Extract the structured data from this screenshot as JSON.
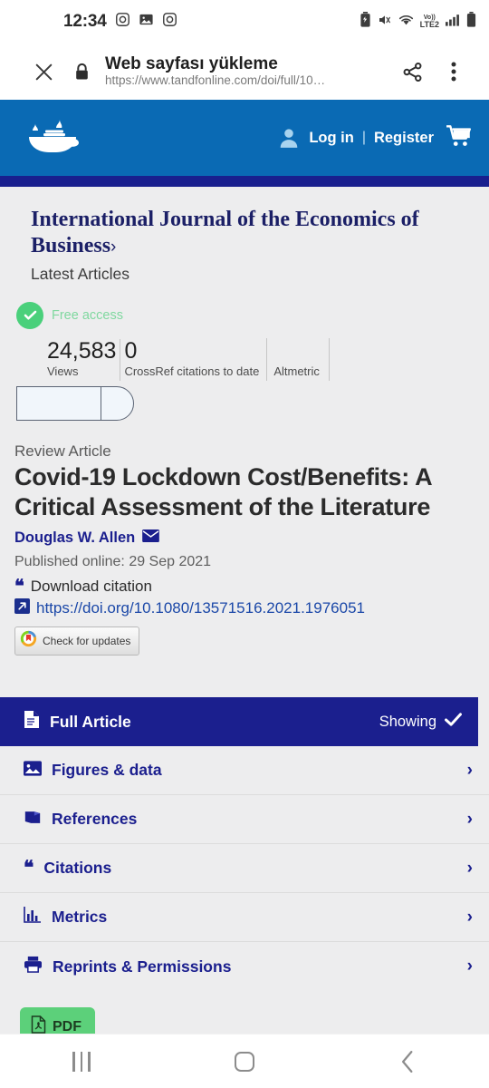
{
  "status_bar": {
    "time": "12:34",
    "left_icons": [
      "instagram-icon",
      "gallery-icon",
      "instagram-icon"
    ],
    "right_icons": [
      "battery-saver-icon",
      "vibrate-icon",
      "wifi-icon",
      "volte-lte2-icon",
      "signal-bars-icon",
      "battery-icon"
    ],
    "network_label": "Vo))",
    "network_type": "LTE2"
  },
  "browser": {
    "title": "Web sayfası yükleme",
    "url": "https://www.tandfonline.com/doi/full/10…",
    "close_icon": "close-icon",
    "lock_icon": "lock-icon",
    "share_icon": "share-icon",
    "menu_icon": "more-vertical-icon"
  },
  "site_header": {
    "logo": "taylor-francis-lamp-logo",
    "login_label": "Log in",
    "separator": "|",
    "register_label": "Register",
    "cart_icon": "shopping-cart-icon",
    "account_icon": "user-avatar-icon",
    "bg_color": "#0a6ab4",
    "strip_color": "#191f8e"
  },
  "journal": {
    "title": "International Journal of the Economics of Business",
    "chevron": "›",
    "subtitle": "Latest Articles"
  },
  "access": {
    "badge_label": "Free access",
    "badge_icon": "check-circle-icon",
    "badge_color": "#4ad07b"
  },
  "metrics": [
    {
      "value": "24,583",
      "label": "Views"
    },
    {
      "value": "0",
      "label": "CrossRef citations to date"
    },
    {
      "value": "",
      "label": "Altmetric"
    }
  ],
  "article": {
    "type": "Review Article",
    "title": "Covid-19 Lockdown Cost/Benefits: A Critical Assessment of the Literature",
    "author": "Douglas W. Allen",
    "author_mail_icon": "envelope-icon",
    "published": "Published online: 29 Sep 2021",
    "download_citation": "Download citation",
    "download_citation_icon": "quote-icon",
    "doi": "https://doi.org/10.1080/13571516.2021.1976051",
    "doi_icon": "external-link-icon",
    "crossmark_label": "Check for updates",
    "crossmark_icon": "crossmark-icon"
  },
  "tabs": [
    {
      "label": "Full Article",
      "icon": "document-icon",
      "active": true,
      "status": "Showing",
      "status_icon": "check-icon"
    },
    {
      "label": "Figures & data",
      "icon": "image-icon",
      "active": false,
      "chevron": "›"
    },
    {
      "label": "References",
      "icon": "book-icon",
      "active": false,
      "chevron": "›"
    },
    {
      "label": "Citations",
      "icon": "quote-icon",
      "active": false,
      "chevron": "›"
    },
    {
      "label": "Metrics",
      "icon": "bar-chart-icon",
      "active": false,
      "chevron": "›"
    },
    {
      "label": "Reprints & Permissions",
      "icon": "printer-icon",
      "active": false,
      "chevron": "›"
    }
  ],
  "pdf_button": {
    "label": "PDF",
    "icon": "pdf-file-icon",
    "color": "#5cd07a"
  },
  "android_nav": {
    "recents_icon": "recents-icon",
    "home_icon": "home-icon",
    "back_icon": "back-icon"
  }
}
